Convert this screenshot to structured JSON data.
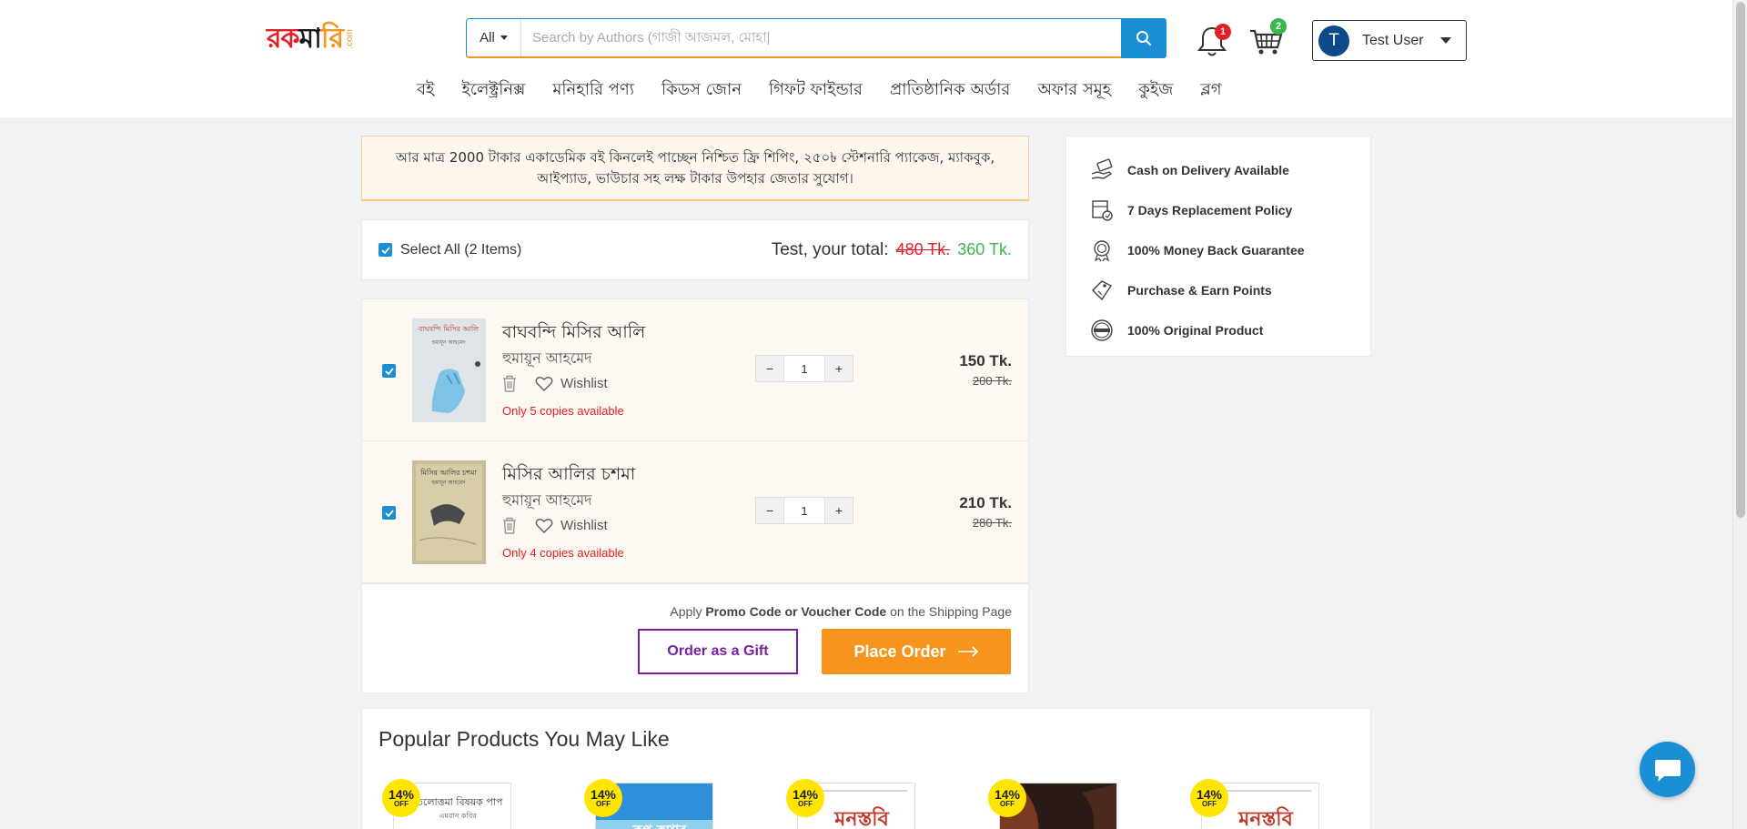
{
  "header": {
    "logo": {
      "part1": "রক",
      "part2": "মা",
      "part3": "রি",
      "suffix": ".com"
    },
    "search": {
      "category": "All",
      "placeholder": "Search by Authors (গাজী আজমল, মোহা|"
    },
    "notifications_count": "1",
    "cart_count": "2",
    "user": {
      "initial": "T",
      "name": "Test User"
    }
  },
  "nav": [
    "বই",
    "ইলেক্ট্রনিক্স",
    "মনিহারি পণ্য",
    "কিডস জোন",
    "গিফট ফাইন্ডার",
    "প্রাতিষ্ঠানিক অর্ডার",
    "অফার সমূহ",
    "কুইজ",
    "ব্লগ"
  ],
  "promo": {
    "text": "আর মাত্র 2000 টাকার একাডেমিক বই কিনলেই পাচ্ছেন নিশ্চিত ফ্রি শিপিং, ২৫০৳ স্টেশনারি প্যাকেজ, ম্যাকবুক, আইপ্যাড, ভাউচার সহ লক্ষ টাকার উপহার জেতার সুযোগ।"
  },
  "cart": {
    "select_all_label": "Select All (2 Items)",
    "total_label": "Test, your total:",
    "total_old": "480 Tk.",
    "total_new": "360 Tk.",
    "items": [
      {
        "title": "বাঘবন্দি মিসির আলি",
        "author": "হুমায়ূন আহমেদ",
        "wishlist": "Wishlist",
        "stock": "Only 5 copies available",
        "qty": "1",
        "price": "150 Tk.",
        "old_price": "200 Tk.",
        "cover_title": "বাঘবন্দি মিসির আলি",
        "cover_author": "হুমায়ূন আহমেদ"
      },
      {
        "title": "মিসির আলির চশমা",
        "author": "হুমায়ূন আহমেদ",
        "wishlist": "Wishlist",
        "stock": "Only 4 copies available",
        "qty": "1",
        "price": "210 Tk.",
        "old_price": "280 Tk.",
        "cover_title": "মিসির আলির চশমা",
        "cover_author": "হুমায়ূন আহমেদ"
      }
    ],
    "promo_hint": {
      "pre": "Apply ",
      "bold": "Promo Code or Voucher Code",
      "post": " on the Shipping Page"
    },
    "gift_button": "Order as a Gift",
    "place_order_button": "Place Order"
  },
  "benefits": [
    {
      "icon": "cash-hand-icon",
      "text": "Cash on Delivery Available"
    },
    {
      "icon": "replacement-box-icon",
      "text": "7 Days Replacement Policy"
    },
    {
      "icon": "money-back-badge-icon",
      "text": "100% Money Back Guarantee"
    },
    {
      "icon": "earn-points-icon",
      "text": "Purchase & Earn Points"
    },
    {
      "icon": "original-stamp-icon",
      "text": "100% Original Product"
    }
  ],
  "popular": {
    "title": "Popular Products You May Like",
    "products": [
      {
        "discount": "14%",
        "off": "OFF",
        "cover_text": "তিলোত্তমা বিষয়ক পাপ",
        "cover_author": "এমরান কবির"
      },
      {
        "discount": "14%",
        "off": "OFF",
        "cover_text": "রূপ কথার",
        "cover_author": ""
      },
      {
        "discount": "14%",
        "off": "OFF",
        "cover_text": "মনস্তবি",
        "cover_author": ""
      },
      {
        "discount": "14%",
        "off": "OFF",
        "cover_text": "",
        "cover_author": ""
      },
      {
        "discount": "14%",
        "off": "OFF",
        "cover_text": "মনস্তবি",
        "cover_author": ""
      }
    ]
  },
  "colors": {
    "accent": "#1a8fd6",
    "orange": "#f7941d",
    "green": "#3cb54a",
    "red": "#e31e24",
    "purple": "#7b1fa2"
  }
}
